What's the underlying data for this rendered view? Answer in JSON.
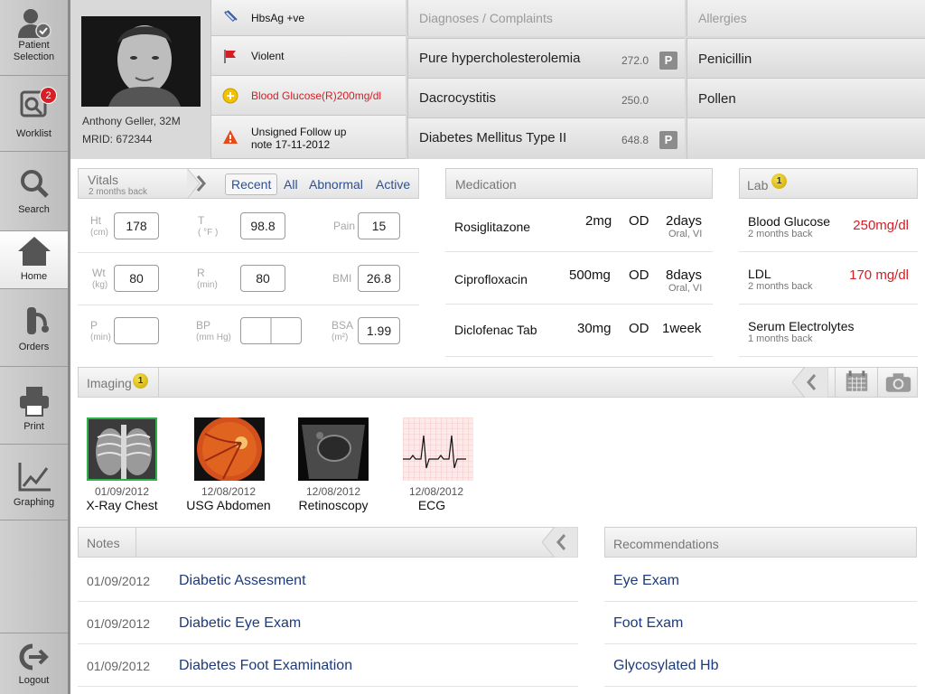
{
  "sidebar": {
    "items": [
      {
        "label": "Patient\nSelection",
        "l1": "Patient",
        "l2": "Selection"
      },
      {
        "label": "Worklist",
        "badge": "2"
      },
      {
        "label": "Search"
      },
      {
        "label": "Home"
      },
      {
        "label": "Orders"
      },
      {
        "label": "Print"
      },
      {
        "label": "Graphing"
      },
      {
        "label": "Logout"
      }
    ]
  },
  "patient": {
    "name_line": "Anthony Geller, 32M",
    "mrid_line": "MRID: 672344"
  },
  "alerts": [
    {
      "text": "HbsAg +ve",
      "icon": "vial-icon"
    },
    {
      "text": "Violent",
      "icon": "flag-icon"
    },
    {
      "text": "Blood Glucose(R)200mg/dl",
      "icon": "warning-circle-icon",
      "color": "#d41e24"
    },
    {
      "text1": "Unsigned Follow up",
      "text2": "note 17-11-2012",
      "icon": "warning-triangle-icon"
    }
  ],
  "diagnoses": {
    "header": "Diagnoses / Complaints",
    "items": [
      {
        "name": "Pure hypercholesterolemia",
        "code": "272.0",
        "badge": "P"
      },
      {
        "name": "Dacrocystitis",
        "code": "250.0",
        "badge": ""
      },
      {
        "name": "Diabetes Mellitus Type II",
        "code": "648.8",
        "badge": "P"
      }
    ]
  },
  "allergies": {
    "header": "Allergies",
    "items": [
      "Penicillin",
      "Pollen",
      ""
    ]
  },
  "vitals": {
    "title": "Vitals",
    "subtitle": "2 months back",
    "tabs": [
      "Recent",
      "All",
      "Abnormal",
      "Active"
    ],
    "fields": [
      {
        "label": "Ht",
        "unit": "(cm)",
        "value": "178"
      },
      {
        "label": "T",
        "unit": "( °F )",
        "value": "98.8"
      },
      {
        "label": "Pain",
        "unit": "",
        "value": "15"
      },
      {
        "label": "Wt",
        "unit": "(kg)",
        "value": "80"
      },
      {
        "label": "R",
        "unit": "(min)",
        "value": "80"
      },
      {
        "label": "BMI",
        "unit": "",
        "value": "26.8"
      },
      {
        "label": "P",
        "unit": "(min)",
        "value": ""
      },
      {
        "label": "BP",
        "unit": "(mm Hg)",
        "value": ""
      },
      {
        "label": "BSA",
        "unit": "(m²)",
        "value": "1.99"
      }
    ]
  },
  "medication": {
    "header": "Medication",
    "items": [
      {
        "name": "Rosiglitazone",
        "dose": "2mg",
        "freq": "OD",
        "dur": "2days",
        "route": "Oral, VI"
      },
      {
        "name": "Ciprofloxacin",
        "dose": "500mg",
        "freq": "OD",
        "dur": "8days",
        "route": "Oral, VI"
      },
      {
        "name": "Diclofenac Tab",
        "dose": "30mg",
        "freq": "OD",
        "dur": "1week",
        "route": ""
      }
    ]
  },
  "lab": {
    "header": "Lab",
    "badge": "1",
    "items": [
      {
        "name": "Blood Glucose",
        "time": "2 months back",
        "value": "250mg/dl"
      },
      {
        "name": "LDL",
        "time": "2 months back",
        "value": "170 mg/dl"
      },
      {
        "name": "Serum Electrolytes",
        "time": "1 months back",
        "value": ""
      }
    ]
  },
  "imaging": {
    "header": "Imaging",
    "badge": "1",
    "items": [
      {
        "date": "01/09/2012",
        "name": "X-Ray Chest"
      },
      {
        "date": "12/08/2012",
        "name": "USG Abdomen"
      },
      {
        "date": "12/08/2012",
        "name": "Retinoscopy"
      },
      {
        "date": "12/08/2012",
        "name": "ECG"
      }
    ]
  },
  "notes": {
    "header": "Notes",
    "items": [
      {
        "date": "01/09/2012",
        "title": "Diabetic Assesment"
      },
      {
        "date": "01/09/2012",
        "title": "Diabetic Eye Exam"
      },
      {
        "date": "01/09/2012",
        "title": "Diabetes Foot Examination"
      }
    ]
  },
  "recommendations": {
    "header": "Recommendations",
    "items": [
      "Eye Exam",
      "Foot Exam",
      "Glycosylated Hb"
    ]
  },
  "colors": {
    "accent_link": "#1d3a7a",
    "alert_red": "#d41e24",
    "tab_blue": "#2f4f8f"
  }
}
